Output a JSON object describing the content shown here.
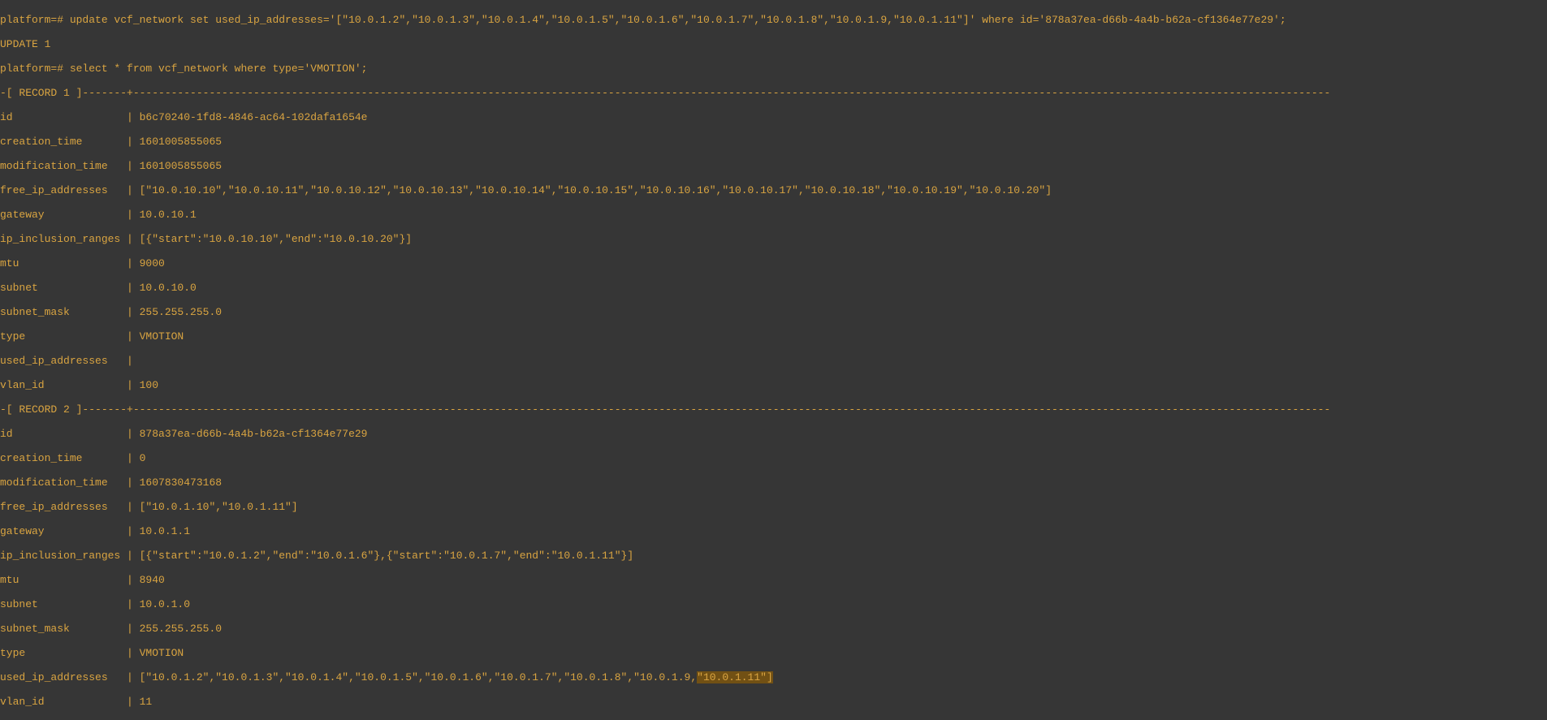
{
  "lines": [
    "platform=# update vcf_network set used_ip_addresses='[\"10.0.1.2\",\"10.0.1.3\",\"10.0.1.4\",\"10.0.1.5\",\"10.0.1.6\",\"10.0.1.7\",\"10.0.1.8\",\"10.0.1.9,\"10.0.1.11\"]' where id='878a37ea-d66b-4a4b-b62a-cf1364e77e29';",
    "UPDATE 1",
    "platform=# select * from vcf_network where type='VMOTION';",
    "-[ RECORD 1 ]-------+---------------------------------------------------------------------------------------------------------------------------------------------------------------------------------------------",
    "id                  | b6c70240-1fd8-4846-ac64-102dafa1654e",
    "creation_time       | 1601005855065",
    "modification_time   | 1601005855065",
    "free_ip_addresses   | [\"10.0.10.10\",\"10.0.10.11\",\"10.0.10.12\",\"10.0.10.13\",\"10.0.10.14\",\"10.0.10.15\",\"10.0.10.16\",\"10.0.10.17\",\"10.0.10.18\",\"10.0.10.19\",\"10.0.10.20\"]",
    "gateway             | 10.0.10.1",
    "ip_inclusion_ranges | [{\"start\":\"10.0.10.10\",\"end\":\"10.0.10.20\"}]",
    "mtu                 | 9000",
    "subnet              | 10.0.10.0",
    "subnet_mask         | 255.255.255.0",
    "type                | VMOTION",
    "used_ip_addresses   | ",
    "vlan_id             | 100",
    "-[ RECORD 2 ]-------+---------------------------------------------------------------------------------------------------------------------------------------------------------------------------------------------",
    "id                  | 878a37ea-d66b-4a4b-b62a-cf1364e77e29",
    "creation_time       | 0",
    "modification_time   | 1607830473168",
    "free_ip_addresses   | [\"10.0.1.10\",\"10.0.1.11\"]",
    "gateway             | 10.0.1.1",
    "ip_inclusion_ranges | [{\"start\":\"10.0.1.2\",\"end\":\"10.0.1.6\"},{\"start\":\"10.0.1.7\",\"end\":\"10.0.1.11\"}]",
    "mtu                 | 8940",
    "subnet              | 10.0.1.0",
    "subnet_mask         | 255.255.255.0",
    "type                | VMOTION"
  ],
  "used_ip_line_prefix": "used_ip_addresses   | [\"10.0.1.2\",\"10.0.1.3\",\"10.0.1.4\",\"10.0.1.5\",\"10.0.1.6\",\"10.0.1.7\",\"10.0.1.8\",\"10.0.1.9,",
  "used_ip_highlight": "\"10.0.1.11\"]",
  "vlan_line": "vlan_id             | 11"
}
